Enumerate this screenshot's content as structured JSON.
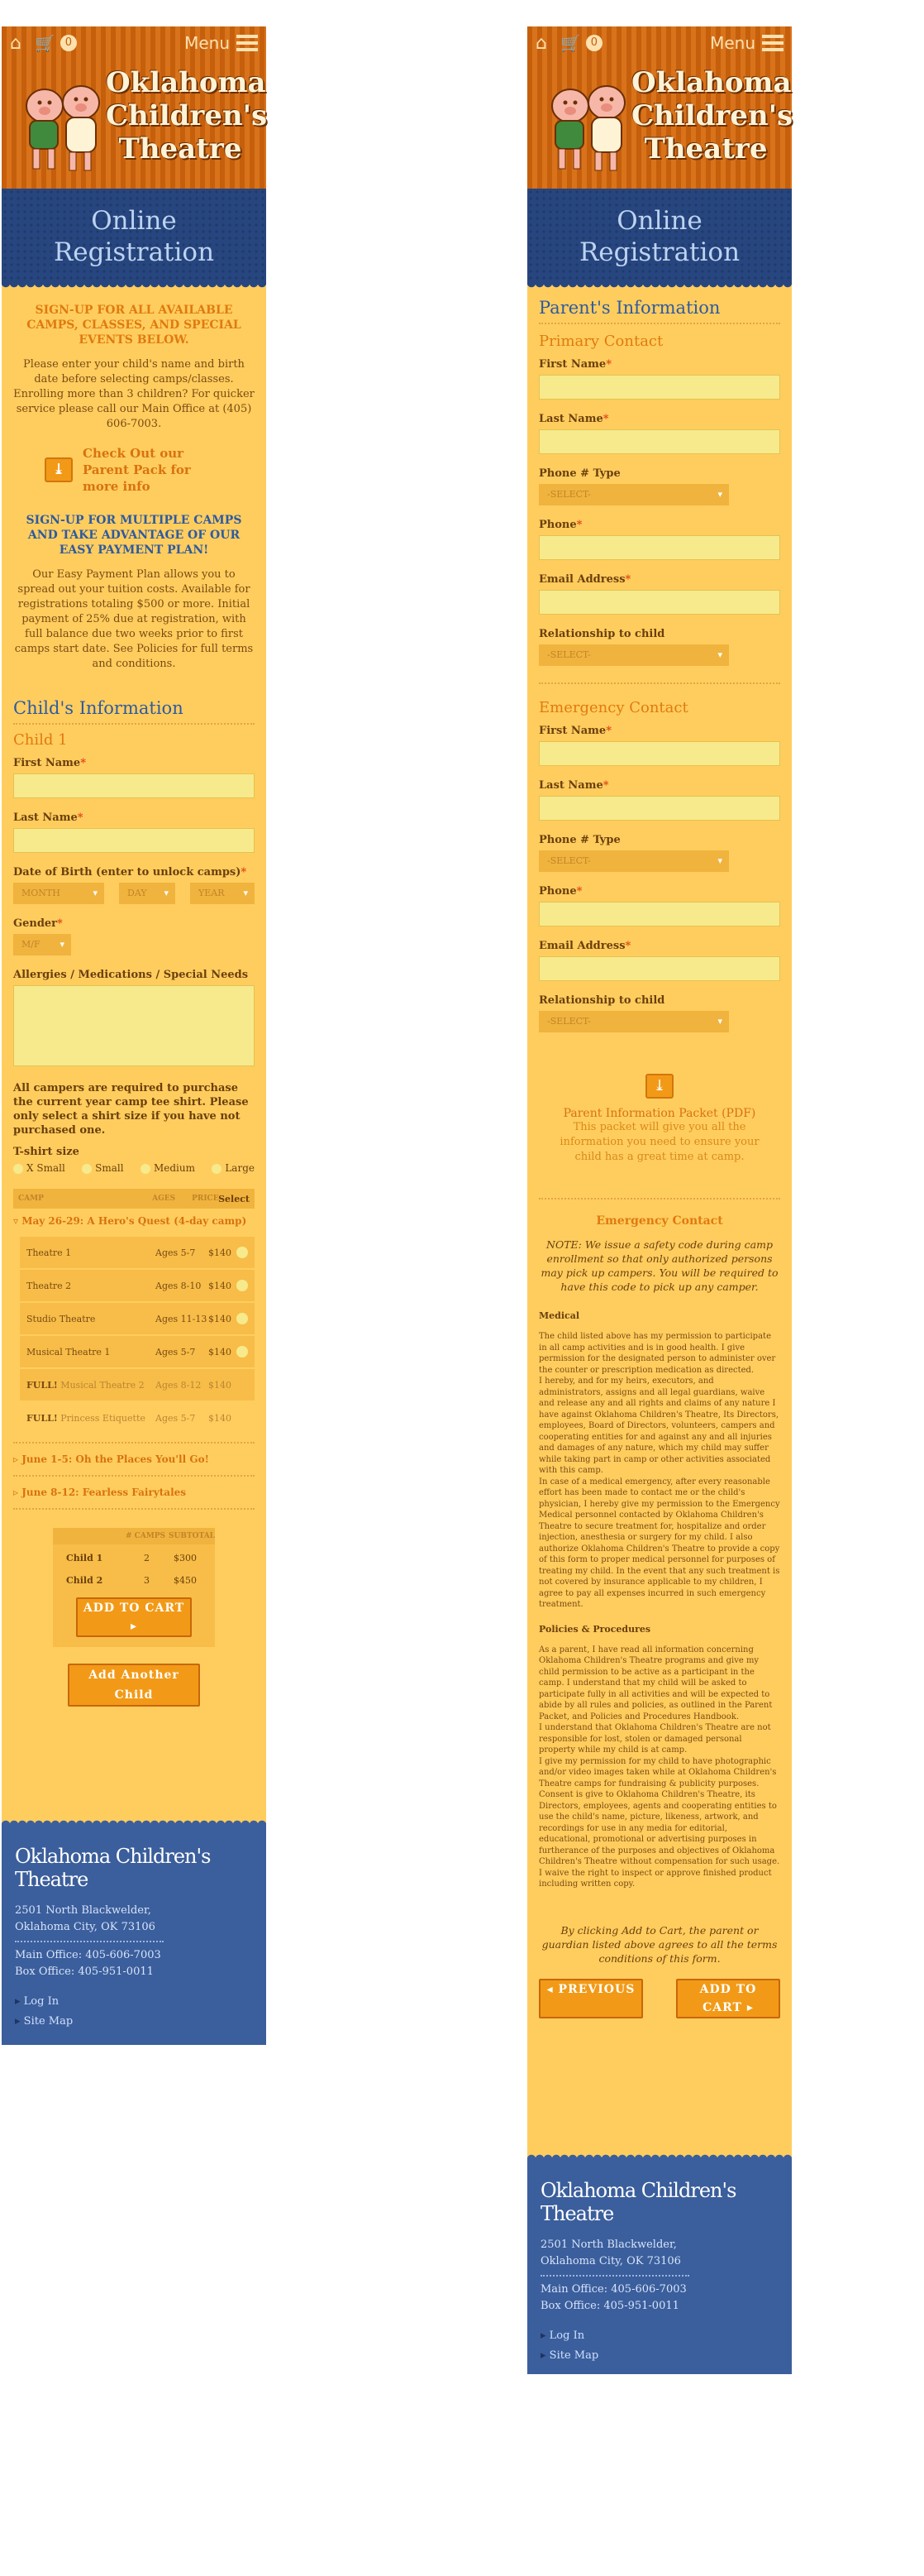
{
  "header": {
    "cart_count": "0",
    "menu_label": "Menu",
    "logo_lines": [
      "Oklahoma",
      "Children's",
      "Theatre"
    ]
  },
  "banner": {
    "line1": "Online",
    "line2": "Registration"
  },
  "child_page": {
    "signup_all": "SIGN-UP FOR ALL AVAILABLE CAMPS, CLASSES, AND SPECIAL EVENTS BELOW.",
    "intro": "Please enter your child's name and birth date before selecting camps/classes. Enrolling more than 3 children? For quicker service please call our Main Office at (405) 606-7003.",
    "parent_pack": "Check Out our Parent Pack for more info",
    "signup_multi": "SIGN-UP FOR MULTIPLE CAMPS AND TAKE ADVANTAGE OF OUR EASY PAYMENT PLAN!",
    "payment_plan": "Our Easy Payment Plan allows you to spread out your tuition costs. Available for registrations totaling $500 or more. Initial payment of 25% due at registration, with full balance due two weeks prior to first camps start date. See Policies for full terms and conditions.",
    "child_info_title": "Child's Information",
    "child_label": "Child 1",
    "first_name": "First Name",
    "last_name": "Last Name",
    "dob": "Date of Birth (enter to unlock camps)",
    "month": "MONTH",
    "day": "DAY",
    "year": "YEAR",
    "gender": "Gender",
    "gender_sel": "M/F",
    "allergies": "Allergies / Medications / Special Needs",
    "shirt_note": "All campers are required to purchase the current year camp tee shirt. Please only select a shirt size if you have not purchased one.",
    "tshirt_label": "T-shirt size",
    "sizes": [
      "X Small",
      "Small",
      "Medium",
      "Large"
    ],
    "camp_head": {
      "camp": "CAMP",
      "ages": "AGES",
      "price": "PRICE",
      "select": "Select"
    },
    "camp1_title": "May 26-29: A Hero's Quest (4-day camp)",
    "sessions": [
      {
        "full": "",
        "name": "Theatre 1",
        "ages": "Ages 5-7",
        "price": "$140"
      },
      {
        "full": "",
        "name": "Theatre 2",
        "ages": "Ages 8-10",
        "price": "$140"
      },
      {
        "full": "",
        "name": "Studio Theatre",
        "ages": "Ages 11-13",
        "price": "$140"
      },
      {
        "full": "",
        "name": "Musical Theatre 1",
        "ages": "Ages 5-7",
        "price": "$140"
      },
      {
        "full": "FULL!",
        "name": "Musical Theatre 2",
        "ages": "Ages 8-12",
        "price": "$140"
      },
      {
        "full": "FULL!",
        "name": "Princess Etiquette",
        "ages": "Ages 5-7",
        "price": "$140"
      }
    ],
    "camp2_title": "June 1-5: Oh the Places You'll Go!",
    "camp3_title": "June 8-12: Fearless Fairytales",
    "summary_head": {
      "camps": "# CAMPS",
      "subtotal": "SUBTOTAL"
    },
    "summary_rows": [
      {
        "child": "Child 1",
        "camps": "2",
        "subtotal": "$300"
      },
      {
        "child": "Child 2",
        "camps": "3",
        "subtotal": "$450"
      }
    ],
    "add_to_cart": "ADD TO CART ▸",
    "add_child": "Add Another Child"
  },
  "parent_page": {
    "title": "Parent's Information",
    "primary": "Primary Contact",
    "emergency": "Emergency Contact",
    "first_name": "First Name",
    "last_name": "Last Name",
    "phone_type": "Phone # Type",
    "phone": "Phone",
    "email": "Email Address",
    "relationship": "Relationship to child",
    "select": "-SELECT-",
    "packet_title": "Parent Information Packet (PDF)",
    "packet_desc": "This packet will give you all the information you need to ensure your child has a great time at camp.",
    "emergency_heading": "Emergency Contact",
    "note": "NOTE: We issue a safety code during camp enrollment so that only authorized persons may pick up campers. You will be required to have this code to pick up any camper.",
    "medical_title": "Medical",
    "medical_text": "The child listed above has my permission to participate in all camp activities and is in good health. I give permission for the designated person to administer over the counter or prescription medication as directed.\nI hereby, and for my heirs, executors, and administrators, assigns and all legal guardians, waive and release any and all rights and claims of any nature I have against Oklahoma Children's Theatre, Its Directors, employees, Board of Directors, volunteers, campers and cooperating entities for and against any and all injuries and damages of any nature, which my child may suffer while taking part in camp or other activities associated with this camp.\nIn case of a medical emergency, after every reasonable effort has been made to contact me or the child's physician, I hereby give my permission to the Emergency Medical personnel contacted by Oklahoma Children's Theatre to secure treatment for, hospitalize and order injection, anesthesia or surgery for my child. I also authorize Oklahoma Children's Theatre to provide a copy of this form to proper medical personnel for purposes of treating my child. In the event that any such treatment is not covered by insurance applicable to my children, I agree to pay all expenses incurred in such emergency treatment.",
    "policies_title": "Policies & Procedures",
    "policies_text": "As a parent, I have read all information concerning Oklahoma Children's Theatre programs and give my child permission to be active as a participant in the camp. I understand that my child will be asked to participate fully in all activities and will be expected to abide by all rules and policies, as outlined in the Parent Packet, and Policies and Procedures Handbook.\nI understand that Oklahoma Children's Theatre are not responsible for lost, stolen or damaged personal property while my child is at camp.\nI give my permission for my child to have photographic and/or video images taken while at Oklahoma Children's Theatre camps for fundraising & publicity purposes. Consent is give to Oklahoma Children's Theatre, its Directors, employees, agents and cooperating entities to use the child's name, picture, likeness, artwork, and recordings for use in any media for editorial, educational, promotional or advertising purposes in furtherance of the purposes and objectives of Oklahoma Children's Theatre without compensation for such usage. I waive the right to inspect or approve finished product including written copy.",
    "agree": "By clicking Add to Cart, the parent or guardian listed above agrees to all the terms conditions of this form.",
    "previous": "◂ PREVIOUS",
    "add_to_cart": "ADD TO CART ▸"
  },
  "footer": {
    "logo": "Oklahoma Children's Theatre",
    "address1": "2501 North Blackwelder,",
    "address2": "Oklahoma City, OK 73106",
    "main_office": "Main Office: 405-606-7003",
    "box_office": "Box Office: 405-951-0011",
    "login": "Log In",
    "sitemap": "Site Map"
  },
  "colors": {
    "page": "#ffcd5e",
    "header_orange": "#c55f0c",
    "banner_blue": "#27457e",
    "footer_blue": "#3b5e9c",
    "accent_orange": "#e07a10",
    "heading_blue": "#2e5aa0"
  }
}
